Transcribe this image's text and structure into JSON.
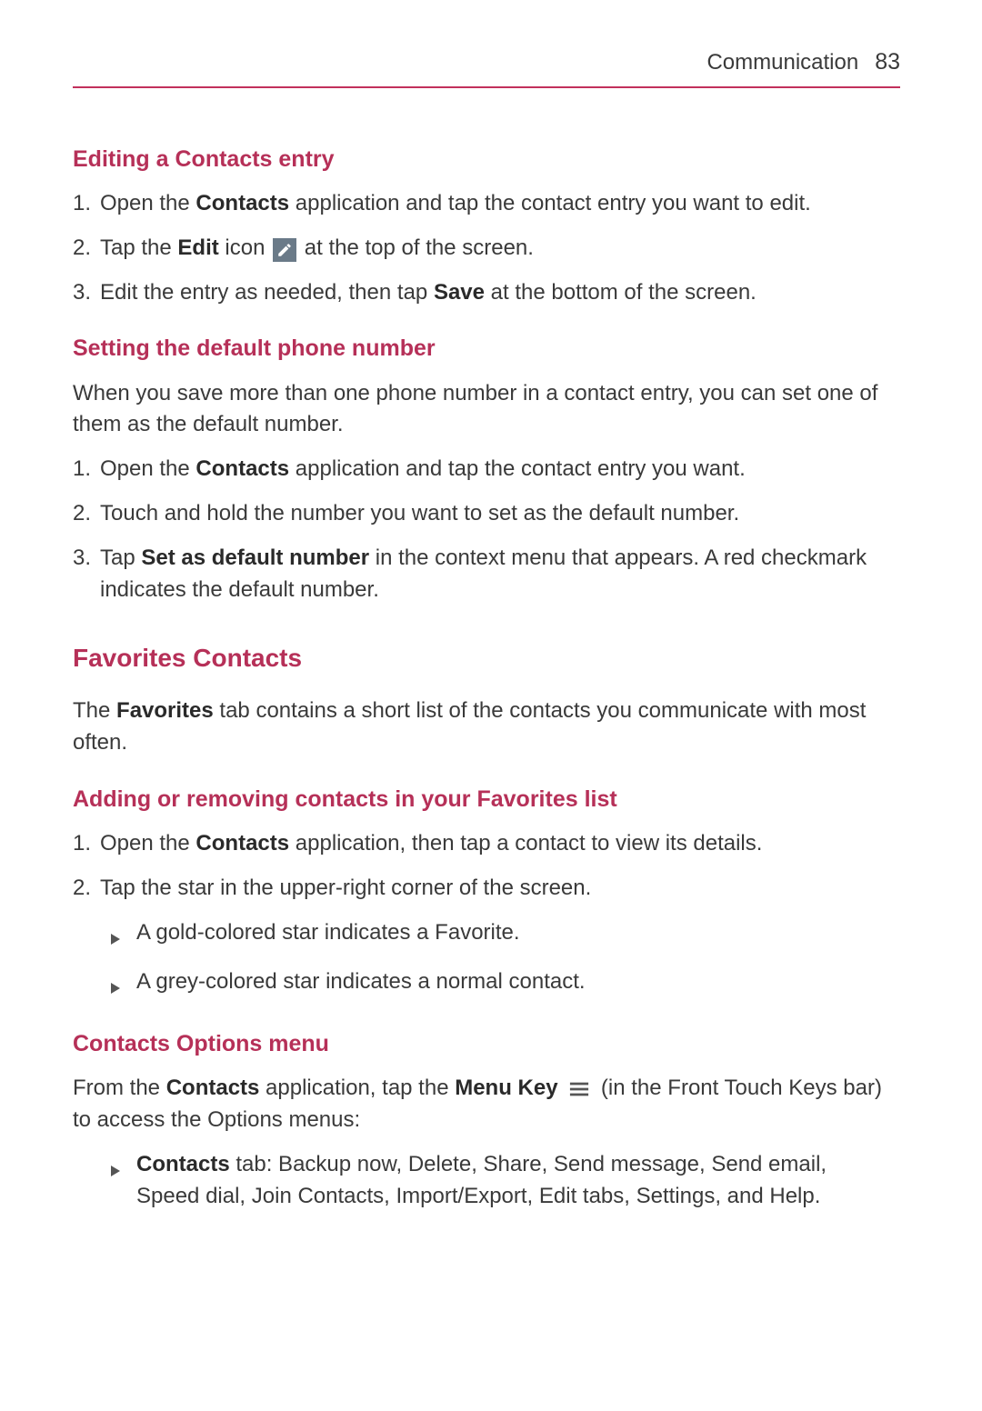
{
  "header": {
    "title": "Communication",
    "page": "83"
  },
  "s1": {
    "heading": "Editing a Contacts entry",
    "items": [
      {
        "num": "1.",
        "a": "Open the ",
        "b": "Contacts",
        "c": " application and tap the contact entry you want to edit."
      },
      {
        "num": "2.",
        "a": "Tap the ",
        "b": "Edit",
        "c": " icon ",
        "d": " at the top of the screen."
      },
      {
        "num": "3.",
        "a": "Edit the entry as needed, then tap ",
        "b": "Save",
        "c": " at the bottom of the screen."
      }
    ]
  },
  "s2": {
    "heading": "Setting the default phone number",
    "intro": "When you save more than one phone number in a contact entry, you can set one of them as the default number.",
    "items": [
      {
        "num": "1.",
        "a": "Open the ",
        "b": "Contacts",
        "c": " application and tap the contact entry you want."
      },
      {
        "num": "2.",
        "a": "Touch and hold the number you want to set as the default number."
      },
      {
        "num": "3.",
        "a": "Tap ",
        "b": "Set as default number",
        "c": " in the context menu that appears. A red checkmark indicates the default number."
      }
    ]
  },
  "s3": {
    "heading": "Favorites Contacts",
    "intro_a": "The ",
    "intro_b": "Favorites",
    "intro_c": " tab contains a short list of the contacts you communicate with most often."
  },
  "s4": {
    "heading": "Adding or removing contacts in your Favorites list",
    "items": [
      {
        "num": "1.",
        "a": "Open the ",
        "b": "Contacts",
        "c": " application, then tap a contact to view its details."
      },
      {
        "num": "2.",
        "a": "Tap the star in the upper-right corner of the screen."
      }
    ],
    "subs": [
      "A gold-colored star indicates a Favorite.",
      "A grey-colored star indicates a normal contact."
    ]
  },
  "s5": {
    "heading": "Contacts Options menu",
    "intro_a": "From the ",
    "intro_b": "Contacts",
    "intro_c": " application, tap the ",
    "intro_d": "Menu Key",
    "intro_e": " (in the Front Touch Keys bar) to access the Options menus:",
    "sub_b": "Contacts",
    "sub_c": " tab: Backup now, Delete, Share, Send message, Send email, Speed dial, Join Contacts, Import/Export, Edit tabs, Settings, and Help."
  }
}
